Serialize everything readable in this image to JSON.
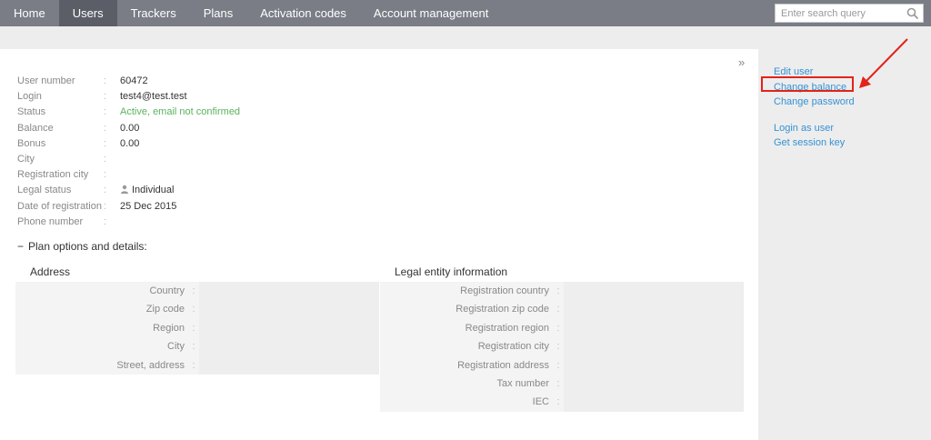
{
  "nav": {
    "items": [
      {
        "label": "Home"
      },
      {
        "label": "Users"
      },
      {
        "label": "Trackers"
      },
      {
        "label": "Plans"
      },
      {
        "label": "Activation codes"
      },
      {
        "label": "Account management"
      }
    ],
    "active": "Users"
  },
  "search": {
    "placeholder": "Enter search query",
    "icon": "search-icon"
  },
  "panel": {
    "collapse_glyph": "»"
  },
  "user": {
    "rows": [
      {
        "label": "User number",
        "value": "60472"
      },
      {
        "label": "Login",
        "value": "test4@test.test"
      },
      {
        "label": "Status",
        "value": "Active, email not confirmed"
      },
      {
        "label": "Balance",
        "value": "0.00"
      },
      {
        "label": "Bonus",
        "value": "0.00"
      },
      {
        "label": "City",
        "value": ""
      },
      {
        "label": "Registration city",
        "value": ""
      },
      {
        "label": "Legal status",
        "value": "Individual"
      },
      {
        "label": "Date of registration",
        "value": "25 Dec 2015"
      },
      {
        "label": "Phone number",
        "value": ""
      }
    ],
    "colon": ":"
  },
  "plan": {
    "toggle_glyph": "−",
    "label": "Plan options and details:"
  },
  "address": {
    "title": "Address",
    "fields": [
      {
        "label": "Country",
        "value": ""
      },
      {
        "label": "Zip code",
        "value": ""
      },
      {
        "label": "Region",
        "value": ""
      },
      {
        "label": "City",
        "value": ""
      },
      {
        "label": "Street, address",
        "value": ""
      }
    ]
  },
  "legal": {
    "title": "Legal entity information",
    "fields": [
      {
        "label": "Registration country",
        "value": ""
      },
      {
        "label": "Registration zip code",
        "value": ""
      },
      {
        "label": "Registration region",
        "value": ""
      },
      {
        "label": "Registration city",
        "value": ""
      },
      {
        "label": "Registration address",
        "value": ""
      },
      {
        "label": "Tax number",
        "value": ""
      },
      {
        "label": "IEC",
        "value": ""
      }
    ]
  },
  "sidebar": {
    "group1": [
      {
        "label": "Edit user"
      },
      {
        "label": "Change balance"
      },
      {
        "label": "Change password"
      }
    ],
    "group2": [
      {
        "label": "Login as user"
      },
      {
        "label": "Get session key"
      }
    ]
  },
  "colors": {
    "topbar": "#7a7d85",
    "topbar_active": "#5b5e66",
    "link": "#3592d4",
    "status_green": "#5ab25f",
    "highlight_red": "#e2231a"
  }
}
